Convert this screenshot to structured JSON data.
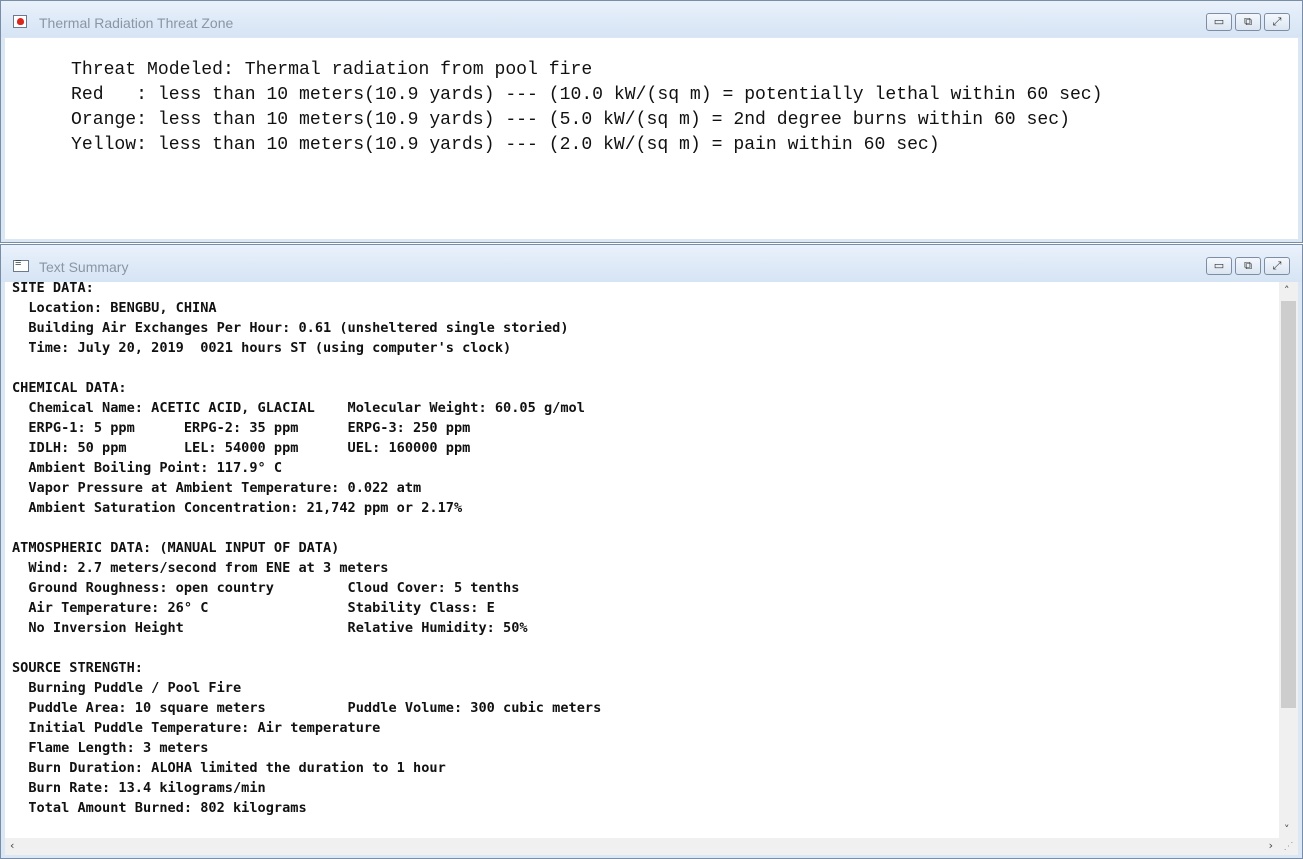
{
  "threat_window": {
    "title": "Thermal Radiation Threat Zone",
    "lines": [
      "Threat Modeled: Thermal radiation from pool fire",
      "Red   : less than 10 meters(10.9 yards) --- (10.0 kW/(sq m) = potentially lethal within 60 sec)",
      "Orange: less than 10 meters(10.9 yards) --- (5.0 kW/(sq m) = 2nd degree burns within 60 sec)",
      "Yellow: less than 10 meters(10.9 yards) --- (2.0 kW/(sq m) = pain within 60 sec)"
    ]
  },
  "summary_window": {
    "title": "Text Summary",
    "text": "SITE DATA:\n  Location: BENGBU, CHINA\n  Building Air Exchanges Per Hour: 0.61 (unsheltered single storied)\n  Time: July 20, 2019  0021 hours ST (using computer's clock)\n\nCHEMICAL DATA:\n  Chemical Name: ACETIC ACID, GLACIAL    Molecular Weight: 60.05 g/mol\n  ERPG-1: 5 ppm      ERPG-2: 35 ppm      ERPG-3: 250 ppm\n  IDLH: 50 ppm       LEL: 54000 ppm      UEL: 160000 ppm\n  Ambient Boiling Point: 117.9° C\n  Vapor Pressure at Ambient Temperature: 0.022 atm\n  Ambient Saturation Concentration: 21,742 ppm or 2.17%\n\nATMOSPHERIC DATA: (MANUAL INPUT OF DATA)\n  Wind: 2.7 meters/second from ENE at 3 meters\n  Ground Roughness: open country         Cloud Cover: 5 tenths\n  Air Temperature: 26° C                 Stability Class: E\n  No Inversion Height                    Relative Humidity: 50%\n\nSOURCE STRENGTH:\n  Burning Puddle / Pool Fire\n  Puddle Area: 10 square meters          Puddle Volume: 300 cubic meters\n  Initial Puddle Temperature: Air temperature\n  Flame Length: 3 meters\n  Burn Duration: ALOHA limited the duration to 1 hour\n  Burn Rate: 13.4 kilograms/min\n  Total Amount Burned: 802 kilograms"
  },
  "controls": {
    "minimize": "▭",
    "maximize": "⧉",
    "close": "⤢"
  },
  "icons": [
    "fire-app-icon",
    "text-summary-icon",
    "scroll-up-icon",
    "scroll-down-icon",
    "scroll-left-icon",
    "scroll-right-icon",
    "resize-grip-icon"
  ],
  "colors": {
    "titlebar": "#d6e4f4",
    "border": "#7a8da6",
    "scroll_thumb": "#cdcdcd"
  }
}
